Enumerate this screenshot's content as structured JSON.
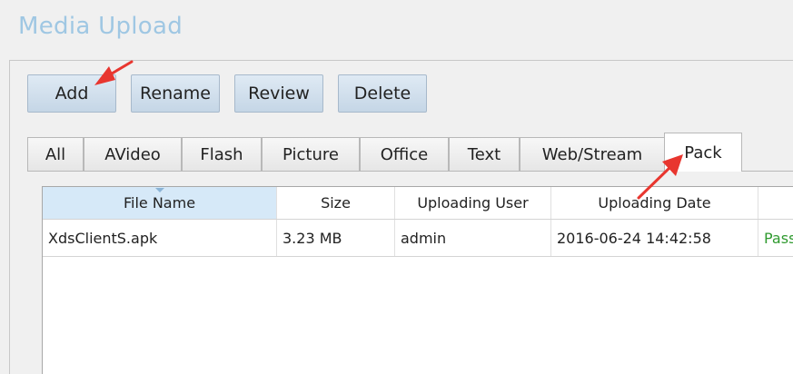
{
  "title": "Media Upload",
  "toolbar": {
    "add_label": "Add",
    "rename_label": "Rename",
    "review_label": "Review",
    "delete_label": "Delete"
  },
  "tabs": [
    {
      "label": "All"
    },
    {
      "label": "AVideo"
    },
    {
      "label": "Flash"
    },
    {
      "label": "Picture"
    },
    {
      "label": "Office"
    },
    {
      "label": "Text"
    },
    {
      "label": "Web/Stream"
    },
    {
      "label": "Pack",
      "active": true
    }
  ],
  "table": {
    "columns": [
      "File Name",
      "Size",
      "Uploading User",
      "Uploading Date",
      ""
    ],
    "rows": [
      [
        "XdsClientS.apk",
        "3.23 MB",
        "admin",
        "2016-06-24 14:42:58",
        "Pass"
      ]
    ]
  },
  "colors": {
    "title": "#9fc7e3",
    "annotation_arrow": "#e8362f",
    "status_pass": "#2f9a2f",
    "sorted_header": "#d6e9f8"
  }
}
